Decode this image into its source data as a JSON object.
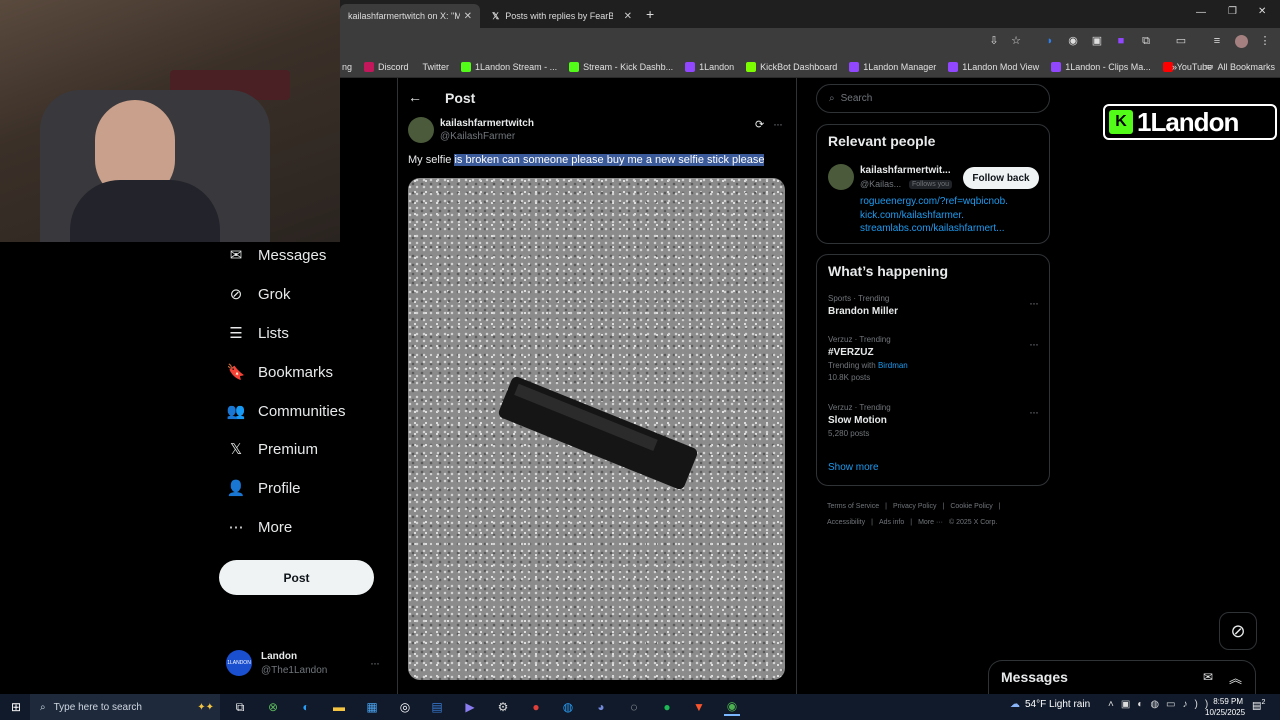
{
  "tabs": [
    {
      "title": "kailashfarmertwitch on X: \"My s"
    },
    {
      "title": "Posts with replies by FearBuck ("
    }
  ],
  "new_tab_label": "+",
  "bookmarks": [
    {
      "label": "ng",
      "color": ""
    },
    {
      "label": "Discord",
      "color": "#c2185b"
    },
    {
      "label": "Twitter",
      "color": ""
    },
    {
      "label": "1Landon Stream - ...",
      "color": "#53fc18"
    },
    {
      "label": "Stream - Kick Dashb...",
      "color": "#53fc18"
    },
    {
      "label": "1Landon",
      "color": "#9146ff"
    },
    {
      "label": "KickBot Dashboard",
      "color": "#7cfc00"
    },
    {
      "label": "1Landon Manager",
      "color": "#9146ff"
    },
    {
      "label": "1Landon Mod View",
      "color": "#9146ff"
    },
    {
      "label": "1Landon - Clips Ma...",
      "color": "#9146ff"
    },
    {
      "label": "YouTube",
      "color": "#ff0000"
    }
  ],
  "bookmarks_more": "»",
  "all_bookmarks": "All Bookmarks",
  "nav": [
    {
      "label": "Messages",
      "icon": "mail-icon"
    },
    {
      "label": "Grok",
      "icon": "grok-icon"
    },
    {
      "label": "Lists",
      "icon": "list-icon"
    },
    {
      "label": "Bookmarks",
      "icon": "bookmark-icon"
    },
    {
      "label": "Communities",
      "icon": "communities-icon"
    },
    {
      "label": "Premium",
      "icon": "x-logo-icon"
    },
    {
      "label": "Profile",
      "icon": "person-icon"
    },
    {
      "label": "More",
      "icon": "more-circle-icon"
    }
  ],
  "post_button": "Post",
  "account": {
    "name": "Landon",
    "handle": "@The1Landon",
    "avatar_text": "1LANDON"
  },
  "post": {
    "header": "Post",
    "author": "kailashfarmertwitch",
    "handle": "@KailashFarmer",
    "text_plain": "My selfie ",
    "text_selected": "is broken can someone please buy me a new selfie stick please",
    "more": "···"
  },
  "search": {
    "placeholder": "Search"
  },
  "relevant": {
    "title": "Relevant people",
    "name": "kailashfarmertwit...",
    "handle": "@Kailas...",
    "follows_you": "Follows you",
    "follow_button": "Follow back",
    "links": [
      "rogueenergy.com/?ref=wqbicnob.",
      "kick.com/kailashfarmer.",
      "streamlabs.com/kailashfarmert..."
    ]
  },
  "happening": {
    "title": "What’s happening",
    "trends": [
      {
        "category": "Sports · Trending",
        "name": "Brandon Miller",
        "extra": "",
        "posts": ""
      },
      {
        "category": "Verzuz · Trending",
        "name": "#VERZUZ",
        "extra": "Trending with",
        "extra_link": "Birdman",
        "posts": "10.8K posts"
      },
      {
        "category": "Verzuz · Trending",
        "name": "Slow Motion",
        "extra": "",
        "posts": "5,280 posts"
      }
    ],
    "show_more": "Show more"
  },
  "footer_links": [
    "Terms of Service",
    "|",
    "Privacy Policy",
    "|",
    "Cookie Policy",
    "|",
    "Accessibility",
    "|",
    "Ads info",
    "|",
    "More ···",
    "© 2025 X Corp."
  ],
  "overlay_logo": "1Landon",
  "messages_drawer": {
    "title": "Messages"
  },
  "taskbar": {
    "search_placeholder": "Type here to search",
    "weather": "54°F  Light rain",
    "time": "8:59 PM",
    "date": "10/25/2025",
    "notif": "2"
  }
}
